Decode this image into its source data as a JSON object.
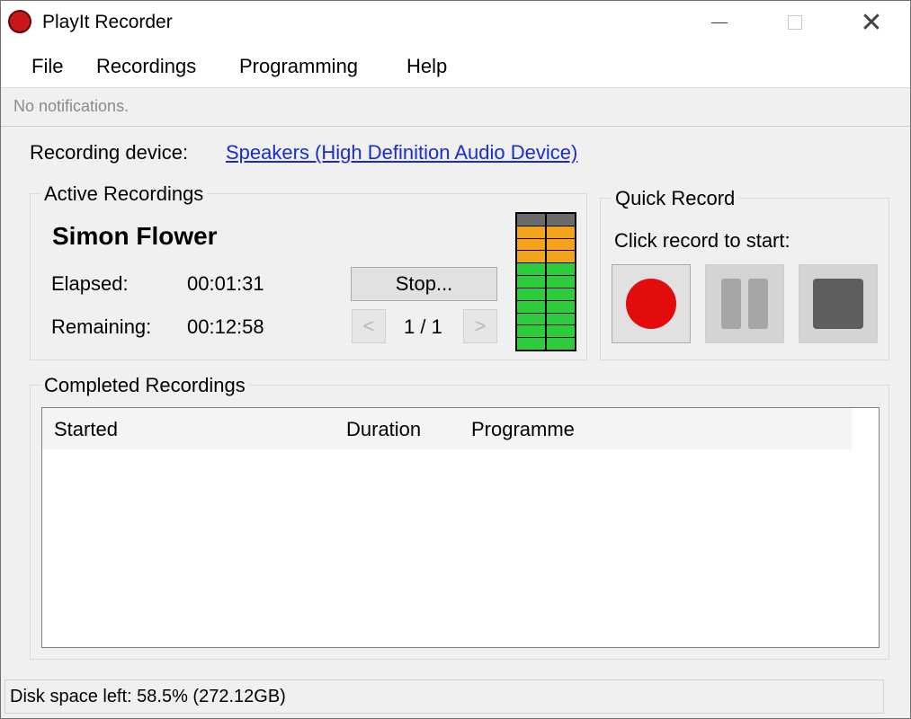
{
  "window": {
    "title": "PlayIt Recorder",
    "close_glyph": "✕"
  },
  "menu": {
    "items": [
      "File",
      "Recordings",
      "Programming",
      "Help"
    ]
  },
  "notification": {
    "text": "No notifications."
  },
  "device": {
    "label": "Recording device:",
    "value": "Speakers (High Definition Audio Device)"
  },
  "active": {
    "title": "Active Recordings",
    "name": "Simon Flower",
    "elapsed_label": "Elapsed:",
    "elapsed_value": "00:01:31",
    "remaining_label": "Remaining:",
    "remaining_value": "00:12:58",
    "stop_label": "Stop...",
    "prev_glyph": "<",
    "next_glyph": ">",
    "page": "1 / 1"
  },
  "meter": {
    "segments_per_channel": 11,
    "colors": {
      "top": "#6b6b6b",
      "warn": "#f5a31a",
      "ok": "#2ecc3a"
    }
  },
  "quick": {
    "title": "Quick Record",
    "hint": "Click record to start:"
  },
  "completed": {
    "title": "Completed Recordings",
    "columns": [
      "Started",
      "Duration",
      "Programme"
    ],
    "rows": []
  },
  "status": {
    "text": "Disk space left: 58.5% (272.12GB)"
  }
}
